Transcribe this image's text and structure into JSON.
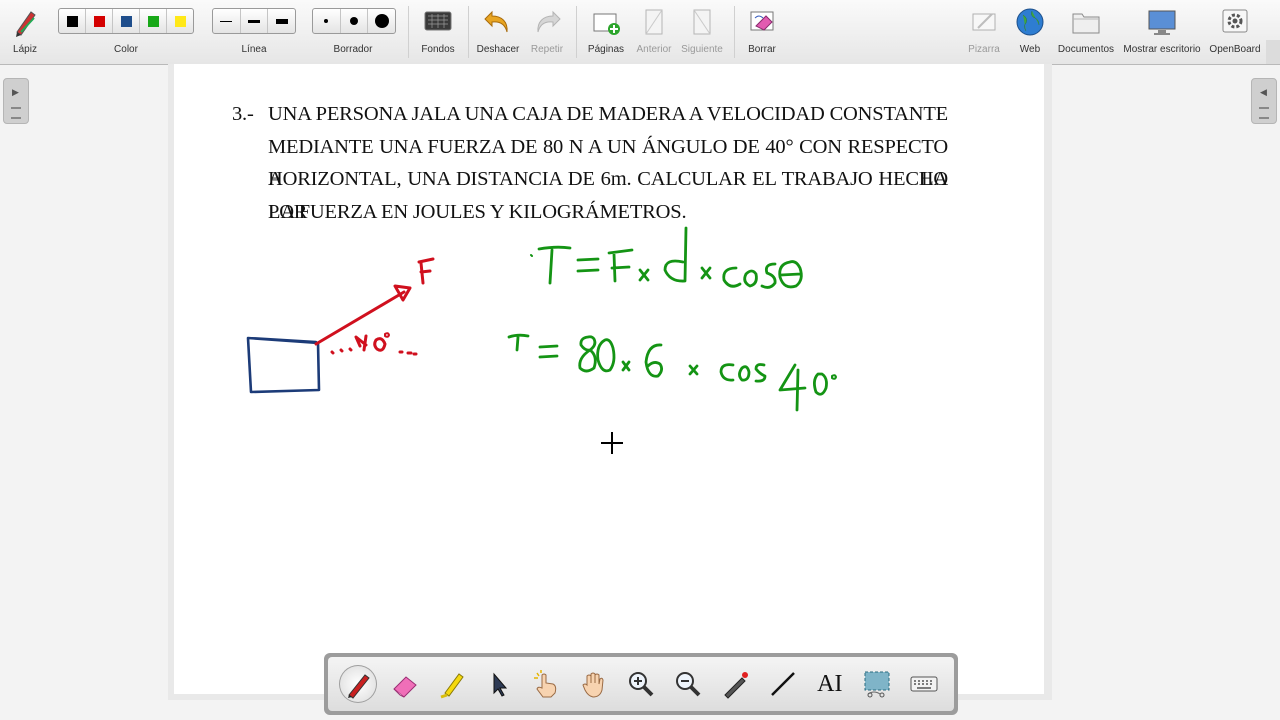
{
  "toolbar": {
    "pen_label": "Lápiz",
    "color_label": "Color",
    "line_label": "Línea",
    "eraser_label": "Borrador",
    "backgrounds_label": "Fondos",
    "undo_label": "Deshacer",
    "redo_label": "Repetir",
    "pages_label": "Páginas",
    "previous_label": "Anterior",
    "next_label": "Siguiente",
    "erase_label": "Borrar",
    "board_label": "Pizarra",
    "web_label": "Web",
    "documents_label": "Documentos",
    "show_desktop_label": "Mostrar escritorio",
    "openboard_label": "OpenBoard",
    "colors": [
      "#000000",
      "#d40000",
      "#1f4e8c",
      "#18a818",
      "#ffe818"
    ]
  },
  "problem": {
    "number": "3.-",
    "lines": [
      "UNA PERSONA JALA UNA CAJA DE MADERA A VELOCIDAD CONSTANTE",
      "MEDIANTE UNA FUERZA DE 80 N A UN ÁNGULO DE 40° CON RESPECTO A LA",
      "HORIZONTAL, UNA DISTANCIA DE 6m. CALCULAR EL TRABAJO HECHO POR",
      "LA FUERZA EN JOULES Y KILOGRÁMETROS."
    ]
  },
  "handwriting": {
    "force_label": "F",
    "angle_label": "40°",
    "formula": "T = F × d × Cosθ",
    "substitution": "T = 80 × 6 × Cos 40°",
    "ink_colors": {
      "red": "#d0101e",
      "blue": "#1c3b78",
      "green": "#149414"
    }
  },
  "dock": {
    "tools": [
      "pen-tool",
      "eraser-tool",
      "highlighter-tool",
      "selector-tool",
      "interactor-tool",
      "hand-tool",
      "zoom-in-tool",
      "zoom-out-tool",
      "laser-pointer-tool",
      "line-tool",
      "text-tool",
      "capture-tool",
      "keyboard-tool"
    ],
    "text_tool_glyph": "AI"
  }
}
